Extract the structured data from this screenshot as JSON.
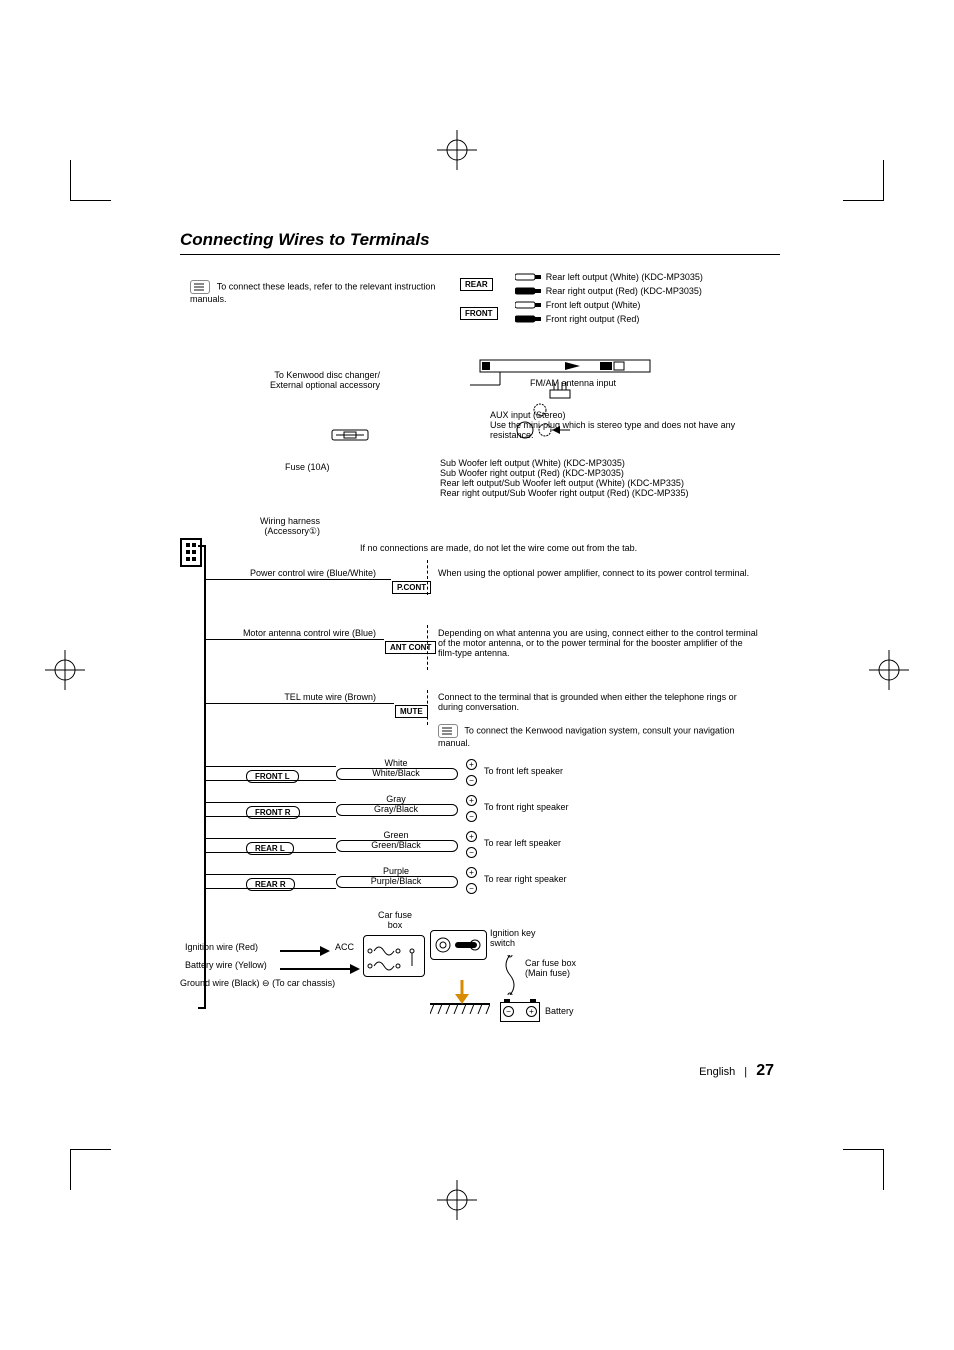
{
  "title": "Connecting Wires to Terminals",
  "intro_note": "To connect these leads, refer to the relevant instruction manuals.",
  "outputs": {
    "rear_label": "REAR",
    "front_label": "FRONT",
    "rear_left": "Rear left output (White) (KDC-MP3035)",
    "rear_right": "Rear right output (Red) (KDC-MP3035)",
    "front_left": "Front left output (White)",
    "front_right": "Front right output (Red)"
  },
  "disc_changer": "To Kenwood disc changer/ External optional accessory",
  "antenna_input": "FM/AM antenna input",
  "aux": {
    "title": "AUX input (Stereo)",
    "desc": "Use the mini-plug which is stereo type and does not have any resistance."
  },
  "fuse": "Fuse (10A)",
  "subwoofer": {
    "sw_left": "Sub Woofer left output (White) (KDC-MP3035)",
    "sw_right": "Sub Woofer right output (Red) (KDC-MP3035)",
    "rear_left_sw": "Rear left output/Sub Woofer left output (White) (KDC-MP335)",
    "rear_right_sw": "Rear right output/Sub Woofer right output (Red) (KDC-MP335)"
  },
  "harness": "Wiring harness (Accessory①)",
  "no_connection_note": "If no connections are made, do not let the wire come out from the tab.",
  "wires": {
    "pcont": {
      "name": "Power control wire (Blue/White)",
      "tag": "P.CONT",
      "desc": "When using the optional power amplifier, connect to its power control terminal."
    },
    "antcont": {
      "name": "Motor antenna control wire (Blue)",
      "tag": "ANT CONT",
      "desc": "Depending on what antenna you are using, connect either to the control terminal of the motor antenna, or to the power terminal for the booster amplifier of the film-type antenna."
    },
    "mute": {
      "name": "TEL mute wire (Brown)",
      "tag": "MUTE",
      "desc": "Connect to the terminal that is grounded when either the telephone rings or during conversation.",
      "nav_note": "To connect the Kenwood navigation system, consult your navigation manual."
    }
  },
  "speakers": [
    {
      "tag": "FRONT L",
      "color1": "White",
      "color2": "White/Black",
      "dest": "To front left speaker"
    },
    {
      "tag": "FRONT R",
      "color1": "Gray",
      "color2": "Gray/Black",
      "dest": "To front right speaker"
    },
    {
      "tag": "REAR L",
      "color1": "Green",
      "color2": "Green/Black",
      "dest": "To rear left speaker"
    },
    {
      "tag": "REAR R",
      "color1": "Purple",
      "color2": "Purple/Black",
      "dest": "To rear right speaker"
    }
  ],
  "power": {
    "car_fuse_box": "Car fuse box",
    "ignition_key": "Ignition key switch",
    "ignition_wire": "Ignition wire (Red)",
    "acc": "ACC",
    "battery_wire": "Battery wire (Yellow)",
    "ground_wire": "Ground wire (Black) ⊖ (To car chassis)",
    "main_fuse": "Car fuse box (Main fuse)",
    "battery": "Battery"
  },
  "footer": {
    "lang": "English",
    "page": "27"
  }
}
